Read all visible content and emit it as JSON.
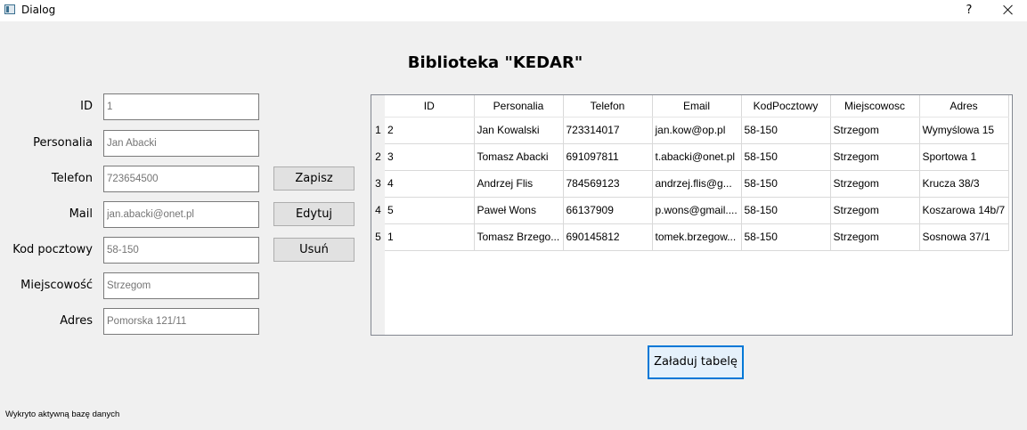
{
  "window": {
    "title": "Dialog",
    "help_label": "?"
  },
  "heading": "Biblioteka \"KEDAR\"",
  "form": {
    "labels": {
      "id": "ID",
      "personalia": "Personalia",
      "telefon": "Telefon",
      "mail": "Mail",
      "kod_pocztowy": "Kod pocztowy",
      "miejscowosc": "Miejscowość",
      "adres": "Adres"
    },
    "placeholders": {
      "id": "1",
      "personalia": "Jan Abacki",
      "telefon": "723654500",
      "mail": "jan.abacki@onet.pl",
      "kod_pocztowy": "58-150",
      "miejscowosc": "Strzegom",
      "adres": "Pomorska 121/11"
    },
    "buttons": {
      "save": "Zapisz",
      "edit": "Edytuj",
      "delete": "Usuń"
    }
  },
  "table": {
    "columns": [
      "ID",
      "Personalia",
      "Telefon",
      "Email",
      "KodPocztowy",
      "Miejscowosc",
      "Adres"
    ],
    "row_numbers": [
      "1",
      "2",
      "3",
      "4",
      "5"
    ],
    "rows": [
      [
        "2",
        "Jan Kowalski",
        "723314017",
        "jan.kow@op.pl",
        "58-150",
        "Strzegom",
        "Wymyślowa 15"
      ],
      [
        "3",
        "Tomasz Abacki",
        "691097811",
        "t.abacki@onet.pl",
        "58-150",
        "Strzegom",
        "Sportowa 1"
      ],
      [
        "4",
        "Andrzej Flis",
        "784569123",
        "andrzej.flis@g...",
        "58-150",
        "Strzegom",
        "Krucza 38/3"
      ],
      [
        "5",
        "Paweł Wons",
        "66137909",
        "p.wons@gmail....",
        "58-150",
        "Strzegom",
        "Koszarowa 14b/7"
      ],
      [
        "1",
        "Tomasz Brzego...",
        "690145812",
        "tomek.brzegow...",
        "58-150",
        "Strzegom",
        "Sosnowa 37/1"
      ]
    ]
  },
  "load_button": "Załaduj tabelę",
  "status": "Wykryto aktywną bazę danych",
  "colors": {
    "focus_border": "#0078d7",
    "window_bg": "#f0f0f0"
  }
}
